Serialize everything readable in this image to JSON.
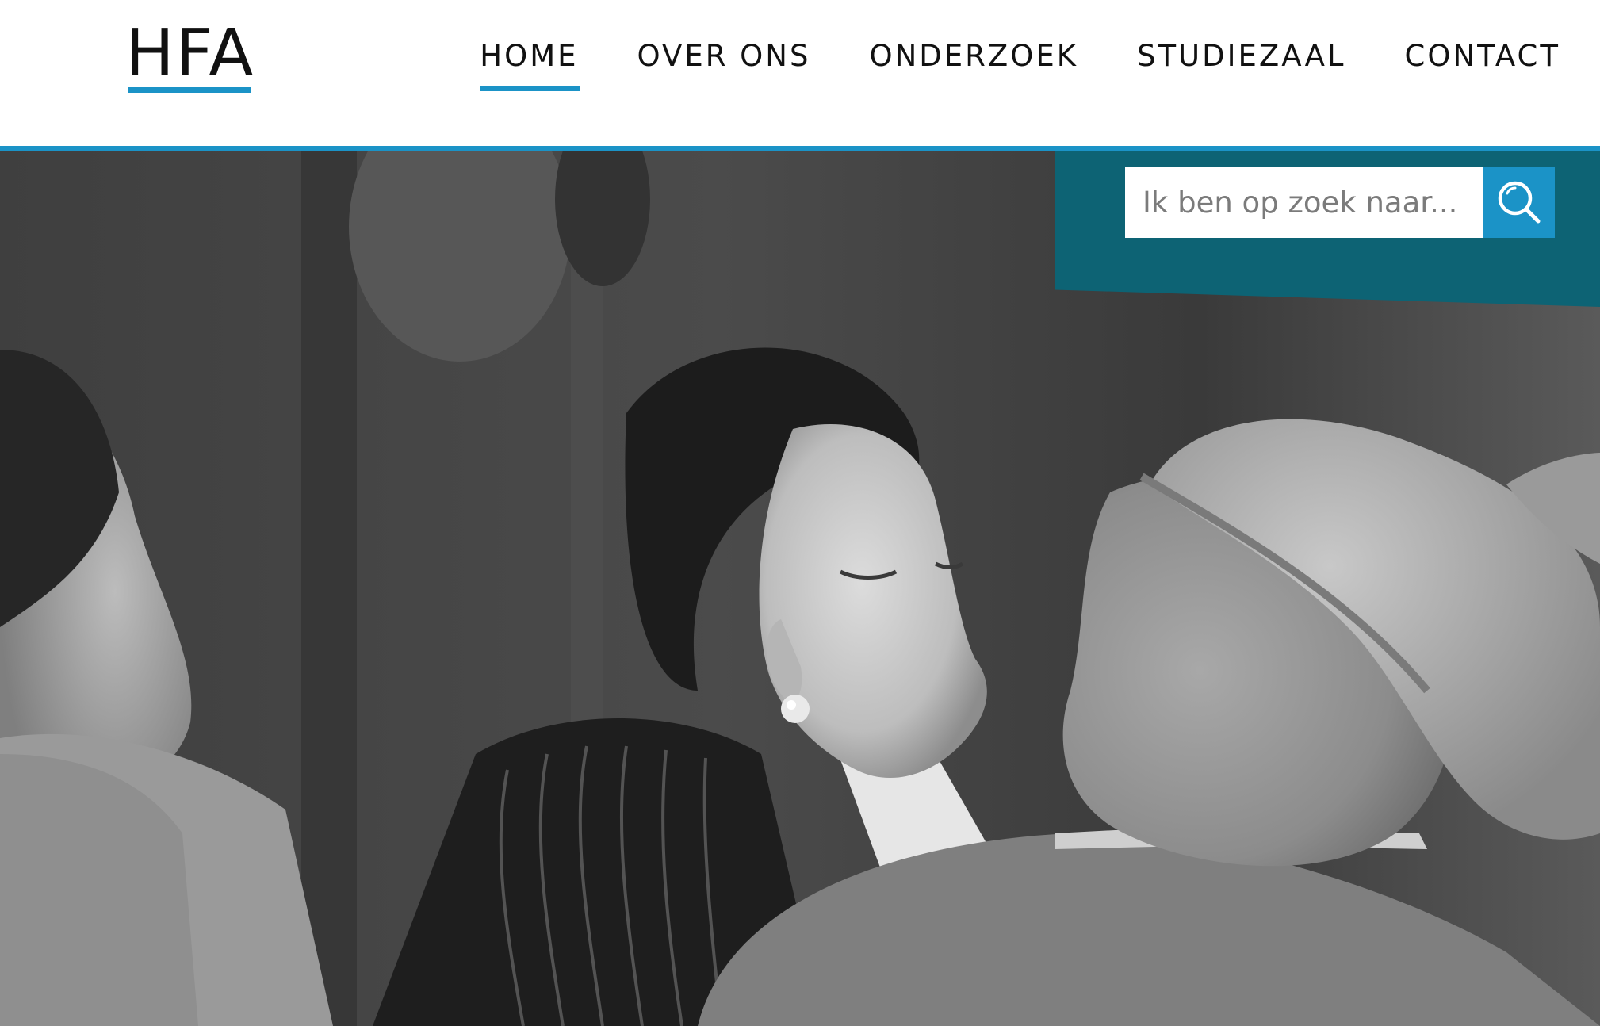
{
  "header": {
    "logo_text": "HFA",
    "accent_color": "#1b93c7"
  },
  "nav": {
    "items": [
      {
        "label": "HOME",
        "active": true
      },
      {
        "label": "OVER ONS",
        "active": false
      },
      {
        "label": "ONDERZOEK",
        "active": false
      },
      {
        "label": "STUDIEZAAL",
        "active": false
      },
      {
        "label": "CONTACT",
        "active": false
      }
    ]
  },
  "search": {
    "placeholder": "Ik ben op zoek naar...",
    "value": "",
    "icon": "search-icon",
    "panel_color": "#0d6374",
    "button_color": "#1b93c7"
  },
  "hero": {
    "image": "black-and-white-archival-photo-of-a-kissing-couple"
  }
}
